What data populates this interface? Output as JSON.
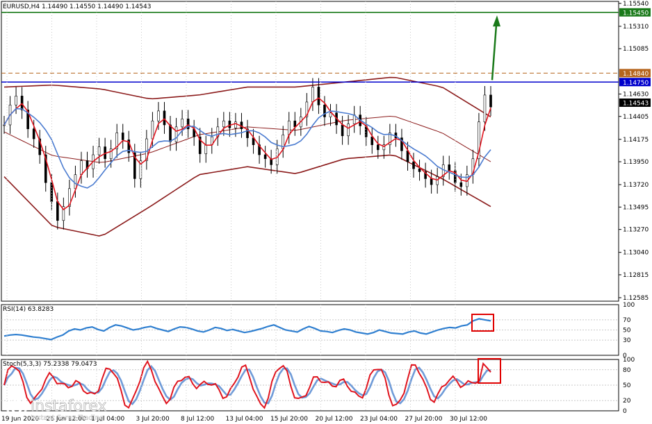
{
  "chart_data": [
    {
      "type": "line",
      "title": "EURUSD,H4  1.14490 1.14550 1.14490 1.14543",
      "symbol": "EURUSD,H4",
      "ohlc": {
        "open": 1.1449,
        "high": 1.1455,
        "low": 1.1449,
        "close": 1.14543
      },
      "ylim": [
        1.1255,
        1.1556
      ],
      "y_ticks": [
        "1.15540",
        "1.15310",
        "1.15085",
        "1.14630",
        "1.14405",
        "1.14175",
        "1.13950",
        "1.13720",
        "1.13495",
        "1.13270",
        "1.13040",
        "1.12815",
        "1.12585"
      ],
      "x_ticks": [
        "19 Jun 2020",
        "26 Jun 12:00",
        "1 Jul 04:00",
        "3 Jul 20:00",
        "8 Jul 12:00",
        "13 Jul 04:00",
        "15 Jul 20:00",
        "20 Jul 12:00",
        "23 Jul 04:00",
        "27 Jul 20:00",
        "30 Jul 12:00"
      ],
      "levels": [
        {
          "value": 1.1545,
          "label": "1.15450",
          "color": "#1a7a1a",
          "style": "solid"
        },
        {
          "value": 1.1484,
          "label": "1.14840",
          "color": "#b5651d",
          "style": "dashed"
        },
        {
          "value": 1.1475,
          "label": "1.14750",
          "color": "#0000cc",
          "style": "solid"
        }
      ],
      "current_price": {
        "value": 1.14543,
        "label": "1.14543"
      },
      "price_series": [
        1.1432,
        1.1452,
        1.1461,
        1.1447,
        1.1428,
        1.1418,
        1.1402,
        1.1374,
        1.1355,
        1.1336,
        1.135,
        1.1368,
        1.1382,
        1.1396,
        1.1388,
        1.1402,
        1.141,
        1.1398,
        1.1408,
        1.1424,
        1.1417,
        1.1404,
        1.1378,
        1.1396,
        1.1418,
        1.1436,
        1.1446,
        1.1432,
        1.1415,
        1.143,
        1.1438,
        1.1428,
        1.142,
        1.1403,
        1.1412,
        1.142,
        1.143,
        1.1436,
        1.1429,
        1.1435,
        1.1428,
        1.1419,
        1.1412,
        1.1402,
        1.1398,
        1.1392,
        1.1408,
        1.1422,
        1.1436,
        1.143,
        1.144,
        1.1455,
        1.147,
        1.1452,
        1.144,
        1.1444,
        1.1432,
        1.1421,
        1.1433,
        1.1442,
        1.1431,
        1.142,
        1.1412,
        1.1407,
        1.1412,
        1.1424,
        1.1419,
        1.1406,
        1.1395,
        1.1388,
        1.1385,
        1.1378,
        1.1372,
        1.138,
        1.1392,
        1.1386,
        1.1374,
        1.137,
        1.1382,
        1.1398,
        1.1435,
        1.1462,
        1.145
      ],
      "bollinger_upper": [
        1.147,
        1.1472,
        1.1468,
        1.1458,
        1.1462,
        1.147,
        1.147,
        1.1475,
        1.148,
        1.147,
        1.144
      ],
      "bollinger_lower": [
        1.138,
        1.133,
        1.132,
        1.135,
        1.1382,
        1.139,
        1.1383,
        1.1398,
        1.1402,
        1.1378,
        1.135
      ],
      "trend_arrow": {
        "from": 1.1477,
        "to": 1.1542,
        "color": "#1a7a1a"
      }
    },
    {
      "type": "line",
      "title": "RSI(14) 63.8283",
      "series": [
        {
          "name": "RSI(14)",
          "value": 63.8283
        }
      ],
      "ylim": [
        0,
        100
      ],
      "y_ticks": [
        "100",
        "70",
        "50",
        "30",
        "0"
      ],
      "rsi_values": [
        38,
        40,
        41,
        40,
        38,
        36,
        35,
        33,
        31,
        36,
        40,
        48,
        52,
        50,
        54,
        56,
        51,
        48,
        55,
        60,
        58,
        54,
        50,
        52,
        55,
        57,
        53,
        50,
        47,
        52,
        56,
        55,
        52,
        48,
        46,
        50,
        55,
        53,
        49,
        51,
        48,
        45,
        47,
        50,
        53,
        57,
        60,
        55,
        50,
        48,
        46,
        52,
        57,
        53,
        48,
        47,
        45,
        49,
        52,
        50,
        46,
        44,
        42,
        45,
        50,
        47,
        44,
        43,
        42,
        46,
        48,
        44,
        42,
        46,
        50,
        53,
        55,
        54,
        58,
        60,
        68,
        72,
        70,
        68
      ]
    },
    {
      "type": "line",
      "title": "Stoch(5,3,3) 75.2338 79.0473",
      "series": [
        {
          "name": "%K",
          "value": 75.2338
        },
        {
          "name": "%D",
          "value": 79.0473
        }
      ],
      "ylim": [
        0,
        100
      ],
      "y_ticks": [
        "100",
        "80",
        "50",
        "20",
        "0"
      ]
    }
  ],
  "colors": {
    "candle": "#000000",
    "bollinger": "#8b1a1a",
    "ma_fast": "#e0141e",
    "ma_slow": "#4a7bd0",
    "rsi": "#2f7fd0",
    "stoch_k": "#e0141e",
    "stoch_d": "#6f9bd8",
    "highlight_box": "#e00000",
    "grid": "#c8c8c8"
  },
  "watermark": {
    "brand": "instaforex",
    "tagline": "Instant Forex Trading"
  }
}
